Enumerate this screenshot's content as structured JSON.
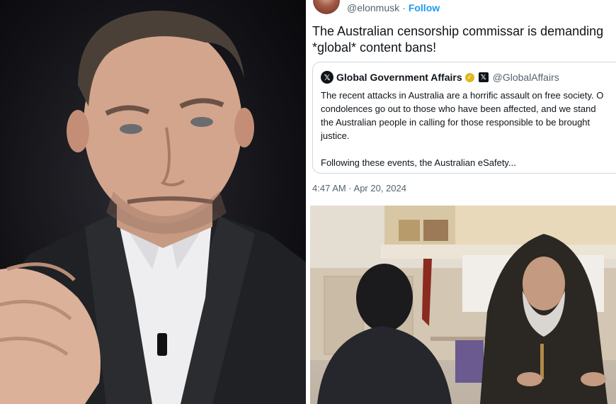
{
  "tweet": {
    "handle": "@elonmusk",
    "separator": "·",
    "follow_label": "Follow",
    "text_line1": "The Australian censorship commissar is demanding",
    "text_line2": "*global* content bans!",
    "timestamp": "4:47 AM · Apr 20, 2024"
  },
  "quoted_tweet": {
    "name": "Global Government Affairs",
    "handle": "@GlobalAffairs",
    "body_lines": [
      "The recent attacks in Australia are a horrific assault on free society. O",
      "condolences go out to those who have been affected, and we stand",
      "the Australian people in calling for those responsible to be brought",
      "justice."
    ],
    "body_line5": "Following these events, the Australian eSafety..."
  },
  "colors": {
    "link_blue": "#1d9bf0",
    "text_dark": "#0f1419",
    "text_gray": "#536471",
    "border": "#cfd9de",
    "verified_gold": "#e2b719"
  },
  "icons": {
    "quote_logo": "x-logo",
    "verified": "gold-check-icon",
    "affiliate": "x-affiliate-badge"
  }
}
